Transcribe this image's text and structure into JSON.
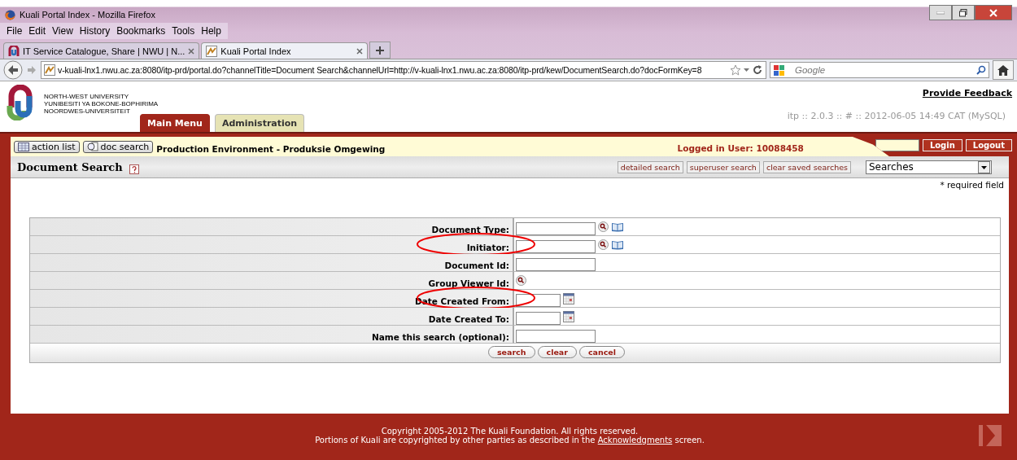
{
  "window": {
    "title": "Kuali Portal Index - Mozilla Firefox"
  },
  "menu": [
    "File",
    "Edit",
    "View",
    "History",
    "Bookmarks",
    "Tools",
    "Help"
  ],
  "tabs": [
    {
      "label": "IT Service Catalogue, Share | NWU | N...",
      "selected": false
    },
    {
      "label": "Kuali Portal Index",
      "selected": true
    }
  ],
  "address_bar": {
    "value": "v-kuali-lnx1.nwu.ac.za:8080/itp-prd/portal.do?channelTitle=Document Search&channelUrl=http://v-kuali-lnx1.nwu.ac.za:8080/itp-prd/kew/DocumentSearch.do?docFormKey=8"
  },
  "search_bar": {
    "placeholder": "Google"
  },
  "header": {
    "logo_lines": [
      "NORTH-WEST UNIVERSITY",
      "YUNIBESITI YA BOKONE-BOPHIRIMA",
      "NOORDWES-UNIVERSITEIT"
    ],
    "feedback_link": "Provide Feedback",
    "version": "itp :: 2.0.3 :: # :: 2012-06-05 14:49 CAT (MySQL)"
  },
  "portal_tabs": [
    {
      "label": "Main Menu",
      "selected": true
    },
    {
      "label": "Administration",
      "selected": false
    }
  ],
  "toolbar": {
    "buttons": [
      "action list",
      "doc search"
    ],
    "environment": "Production Environment - Produksie Omgewing",
    "logged_in": "Logged in User: 10088458",
    "login": "Login",
    "logout": "Logout"
  },
  "search_header": {
    "title": "Document Search",
    "buttons": [
      "detailed search",
      "superuser search",
      "clear saved searches"
    ],
    "select": "Searches",
    "required_note": "* required field"
  },
  "fields": [
    {
      "label": "Document Type:",
      "kind": "text_lookup",
      "circled": false
    },
    {
      "label": "Initiator:",
      "kind": "text_lookup",
      "circled": true
    },
    {
      "label": "Document Id:",
      "kind": "text",
      "circled": false
    },
    {
      "label": "Group Viewer Id:",
      "kind": "lookup",
      "circled": false
    },
    {
      "label": "Date Created From:",
      "kind": "date",
      "circled": true
    },
    {
      "label": "Date Created To:",
      "kind": "date",
      "circled": false
    },
    {
      "label": "Name this search (optional):",
      "kind": "text",
      "circled": false
    }
  ],
  "actions": [
    "search",
    "clear",
    "cancel"
  ],
  "footer": {
    "copyright": "Copyright 2005-2012 The Kuali Foundation. All rights reserved.",
    "portions_before": "Portions of Kuali are copyrighted by other parties as described in the",
    "link": "Acknowledgments",
    "portions_after": "screen."
  }
}
